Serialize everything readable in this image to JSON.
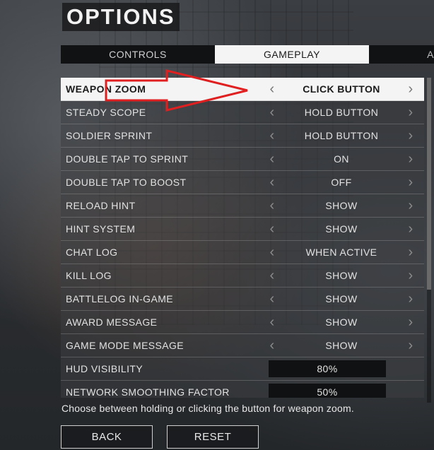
{
  "title": "OPTIONS",
  "tabs": [
    {
      "label": "CONTROLS",
      "active": false
    },
    {
      "label": "GAMEPLAY",
      "active": true
    },
    {
      "label": "A",
      "active": false
    }
  ],
  "settings": [
    {
      "name": "WEAPON ZOOM",
      "value": "CLICK BUTTON",
      "selected": true
    },
    {
      "name": "STEADY SCOPE",
      "value": "HOLD BUTTON"
    },
    {
      "name": "SOLDIER SPRINT",
      "value": "HOLD BUTTON"
    },
    {
      "name": "DOUBLE TAP TO SPRINT",
      "value": "ON"
    },
    {
      "name": "DOUBLE TAP TO BOOST",
      "value": "OFF"
    },
    {
      "name": "RELOAD HINT",
      "value": "SHOW"
    },
    {
      "name": "HINT SYSTEM",
      "value": "SHOW"
    },
    {
      "name": "CHAT LOG",
      "value": "WHEN ACTIVE"
    },
    {
      "name": "KILL LOG",
      "value": "SHOW"
    },
    {
      "name": "BATTLELOG IN-GAME",
      "value": "SHOW"
    },
    {
      "name": "AWARD MESSAGE",
      "value": "SHOW"
    },
    {
      "name": "GAME MODE MESSAGE",
      "value": "SHOW"
    }
  ],
  "sliders": [
    {
      "name": "HUD VISIBILITY",
      "value": "80%"
    },
    {
      "name": "NETWORK SMOOTHING FACTOR",
      "value": "50%"
    }
  ],
  "description": "Choose between holding or clicking the button for weapon zoom.",
  "buttons": {
    "back": "BACK",
    "reset": "RESET"
  },
  "icons": {
    "left": "chevron-left-icon",
    "right": "chevron-right-icon"
  },
  "colors": {
    "annotation_arrow": "#e02020",
    "selected_row": "#f4f4f4",
    "tab_active": "#f4f4f4"
  }
}
